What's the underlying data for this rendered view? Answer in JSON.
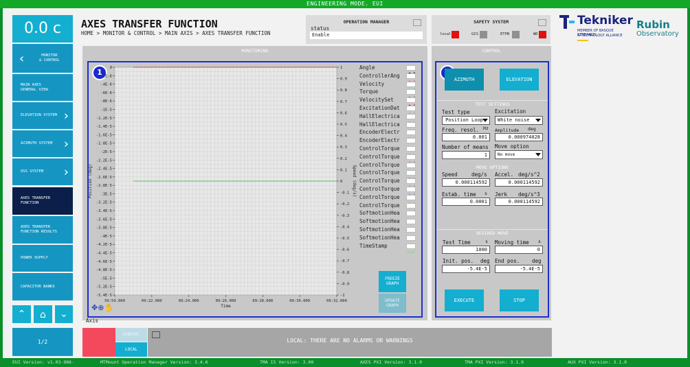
{
  "topbar": {
    "title": "ENGINEERING MODE. EUI"
  },
  "speed_display": {
    "value": "0.0 c"
  },
  "sidebar": {
    "back_label": "MONITOR\n& CONTROL",
    "items": [
      {
        "label": "MAIN AXES GENERAL VIEW",
        "chevron": false,
        "selected": false
      },
      {
        "label": "ELEVATION SYSTEM",
        "chevron": true,
        "selected": false
      },
      {
        "label": "AZIMUTH SYSTEM",
        "chevron": true,
        "selected": false
      },
      {
        "label": "OSS SYSTEM",
        "chevron": true,
        "selected": false
      },
      {
        "label": "AXES TRANSFER FUNCTION",
        "chevron": false,
        "selected": true
      },
      {
        "label": "AXES TRANSFER FUNCTION RESULTS",
        "chevron": false,
        "selected": false
      },
      {
        "label": "POWER SUPPLY",
        "chevron": false,
        "selected": false
      },
      {
        "label": "CAPACITOR BANKS",
        "chevron": false,
        "selected": false
      }
    ],
    "page": "1/2"
  },
  "header": {
    "title": "AXES TRANSFER FUNCTION",
    "breadcrumb": "HOME > MONITOR & CONTROL > MAIN AXIS > AXES TRANSFER FUNCTION"
  },
  "operation_manager": {
    "title": "OPERATION MANAGER",
    "status_label": "status",
    "status_value": "Enable"
  },
  "safety_system": {
    "title": "SAFETY SYSTEM",
    "indicators": [
      {
        "label": "local",
        "color": "#e01010"
      },
      {
        "label": "GIS",
        "color": "#909090"
      },
      {
        "label": "ETPB",
        "color": "#909090"
      },
      {
        "label": "WD",
        "color": "#e01010"
      }
    ]
  },
  "logos": {
    "tekniker": "Tekniker",
    "tekniker_sub1": "MEMBER OF BASQUE RESEARCH",
    "tekniker_sub2": "& TECHNOLOGY ALLIANCE",
    "rubin1": "Rubin",
    "rubin2": "Observatory"
  },
  "monitoring": {
    "title": "MONITORING",
    "badge": "1",
    "freeze": "FREEZE GRAPH",
    "update": "UPDATE GRAPH",
    "axis_label": "Axis"
  },
  "chart_data": {
    "type": "line",
    "xlabel": "Time",
    "ylabel": "Position (deg)",
    "y2label": "Speed (deg/s)",
    "x_ticks": [
      "09:22.000",
      "09:24.000",
      "09:26.000",
      "09:28.000",
      "09:30.000",
      "09:32.000"
    ],
    "x_first": "59:59.000",
    "y_ticks": [
      "0",
      "-2E-6",
      "-4E-6",
      "-6E-6",
      "-8E-6",
      "-1E-5",
      "-1.2E-5",
      "-1.4E-5",
      "-1.6E-5",
      "-1.8E-5",
      "-2E-5",
      "-2.2E-5",
      "-2.4E-5",
      "-2.6E-5",
      "-2.8E-5",
      "-3E-5",
      "-3.2E-5",
      "-3.4E-5",
      "-3.6E-5",
      "-3.8E-5",
      "-4E-5",
      "-4.2E-5",
      "-4.4E-5",
      "-4.6E-5",
      "-4.8E-5",
      "-5E-5",
      "-5.2E-5",
      "-5.4E-5"
    ],
    "y2_ticks": [
      "1",
      "0.9",
      "0.8",
      "0.7",
      "0.6",
      "0.5",
      "0.4",
      "0.3",
      "0.2",
      "0.1",
      "0",
      "-0.1",
      "-0.2",
      "-0.3",
      "-0.4",
      "-0.5",
      "-0.6",
      "-0.7",
      "-0.8",
      "-0.9",
      "-1"
    ],
    "ylim": [
      -5.4e-05,
      0
    ],
    "y2lim": [
      -1,
      1
    ],
    "series": [
      {
        "name": "Angle",
        "color": "#d03030",
        "y_level": 0
      },
      {
        "name": "Velocity",
        "color": "#30b030",
        "y2_level": 0
      }
    ],
    "legend": [
      "Angle",
      "ControllerAng",
      "Velocity",
      "Torque",
      "VelocitySet",
      "ExcitationDat",
      "HallElectrica",
      "HallElectrica",
      "EncoderElectr",
      "EncoderElectr",
      "ControlTorque",
      "ControlTorque",
      "ControlTorque",
      "ControlTorque",
      "ControlTorque",
      "ControlTorque",
      "ControlTorque",
      "ControlTorque",
      "SoftmotionHea",
      "SoftmotionHea",
      "SoftmotionHea",
      "SoftmotionHea",
      "TimeStamp"
    ],
    "legend_colors": [
      "#333333",
      "#d07070",
      "#50c050",
      "#888888",
      "#c02060",
      "#aaaaaa",
      "#b0b0d0",
      "#a0a0e0",
      "#c0a0c0",
      "#cccccc",
      "#bbbbbb",
      "#d08080",
      "#90c090",
      "#a0a0a0",
      "#cc8888",
      "#9090c0",
      "#a0c0a0",
      "#8888cc",
      "#cccccc",
      "#cccccc",
      "#cccccc",
      "#cccccc",
      "#90d090"
    ]
  },
  "control": {
    "title": "CONTROL",
    "badge": "2",
    "azimuth": "AZIMUTH",
    "elevation": "ELEVATION",
    "test_settings": "TEST SETTINGS",
    "test_type_label": "Test type",
    "test_type_value": "Position Loop",
    "excitation_label": "Excitation",
    "excitation_value": "White noise",
    "freq_label": "Freq. resol.",
    "freq_unit": "Hz",
    "freq_value": "0.001",
    "amp_label": "Amplitude",
    "amp_unit": "deg",
    "amp_value": "0.000974028",
    "means_label": "Number of means",
    "means_value": "1",
    "move_option_label": "Move option",
    "move_option_value": "No move",
    "move_options": "MOVE OPTIONS",
    "speed_label": "Speed",
    "speed_unit": "deg/s",
    "speed_value": "0.000114592",
    "accel_label": "Accel.",
    "accel_unit": "deg/s^2",
    "accel_value": "0.000114592",
    "estab_label": "Estab. time",
    "estab_unit": "s",
    "estab_value": "0.0001",
    "jerk_label": "Jerk",
    "jerk_unit": "deg/s^3",
    "jerk_value": "0.000114592",
    "desired_move": "DESIRED MOVE",
    "test_time_label": "Test Time",
    "test_time_unit": "s",
    "test_time_value": "1000",
    "moving_time_label": "Moving time",
    "moving_time_unit": "s",
    "moving_time_value": "0",
    "init_label": "Init. pos.",
    "init_unit": "deg",
    "init_value": "-5.4E-5",
    "end_label": "End pos.",
    "end_unit": "deg",
    "end_value": "-5.4E-5",
    "execute": "EXECUTE",
    "stop": "STOP"
  },
  "alarms": {
    "general": "GENERAL",
    "local": "LOCAL",
    "message": "LOCAL: THERE ARE NO ALARMS OR WARNINGS"
  },
  "footer": [
    {
      "text": "EUI Version: v1.03-986-"
    },
    {
      "text": "MTMount Operation Manager Version: 3.4.6"
    },
    {
      "text": "TMA IS Version: 3.00"
    },
    {
      "text": "AXES PXI Version: 3.1.0"
    },
    {
      "text": "TMA PXI Version: 3.1.0"
    },
    {
      "text": "AUX PXI Version: 3.1.0"
    }
  ]
}
